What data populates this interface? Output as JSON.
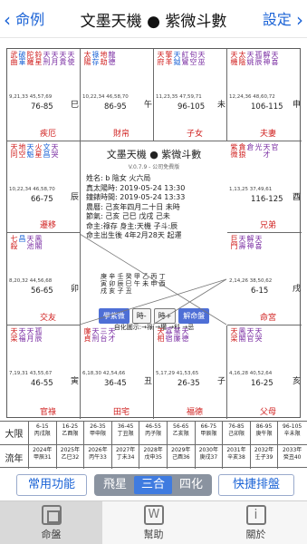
{
  "top": {
    "back_label": "命例",
    "title": "文墨天機 ● 紫微斗數",
    "settings_label": "設定"
  },
  "colors": {
    "red": "#d0201f",
    "blue": "#1b63d6",
    "purple": "#7b2fa3",
    "green": "#2c8a2c"
  },
  "cells": [
    {
      "id": "c1",
      "branch": "巳",
      "range": "76-85",
      "palace": "疾厄",
      "ages": "9,21,33\n45,57,69",
      "stars": [
        "武曲",
        "破軍",
        "陀羅",
        "鈴星",
        "天刑",
        "天月",
        "天貴",
        "天使",
        "天虛"
      ]
    },
    {
      "id": "c2",
      "branch": "午",
      "range": "86-95",
      "palace": "財帛",
      "ages": "10,22,34\n46,58,70",
      "stars": [
        "太陽",
        "祿存",
        "地劫",
        "龍德"
      ]
    },
    {
      "id": "c3",
      "branch": "未",
      "range": "96-105",
      "palace": "子女",
      "ages": "11,23,35\n47,59,71",
      "stars": [
        "天府",
        "擎羊",
        "天鉞",
        "紅鸞",
        "旬空",
        "天巫",
        "華蓋"
      ]
    },
    {
      "id": "c4",
      "branch": "申",
      "range": "106-115",
      "palace": "夫妻",
      "ages": "12,24,36\n48,60,72",
      "stars": [
        "天機",
        "太陰",
        "天姚",
        "孤辰",
        "解神",
        "天喜",
        "天廚",
        "天德"
      ]
    },
    {
      "id": "c5",
      "branch": "辰",
      "range": "66-75",
      "palace": "遷移",
      "ages": "10,22,34\n46,58,70",
      "stars": [
        "天同",
        "地空",
        "天魁",
        "火星",
        "文昌",
        "天哭",
        "大耗"
      ]
    },
    {
      "id": "c6",
      "branch": "酉",
      "range": "116-125",
      "palace": "兄弟",
      "ages": "1,13,25\n37,49,61",
      "stars": [
        "紫微",
        "貪狼",
        "倉",
        "光",
        "天才",
        "官",
        "天封",
        "誥"
      ]
    },
    {
      "id": "c7",
      "branch": "卯",
      "range": "56-65",
      "palace": "交友",
      "ages": "8,20,32\n44,56,68",
      "stars": [
        "七殺",
        "昌",
        "天池",
        "鳳閣"
      ]
    },
    {
      "id": "c8",
      "branch": "戌",
      "range": "6-15",
      "palace": "命宮",
      "ages": "2,14,26\n38,50,62",
      "stars": [
        "巨門",
        "天壽",
        "解神",
        "天喜"
      ]
    },
    {
      "id": "c9",
      "branch": "寅",
      "range": "46-55",
      "palace": "官祿",
      "ages": "7,19,31\n43,55,67",
      "stars": [
        "天梁",
        "天福",
        "天月",
        "孤辰"
      ]
    },
    {
      "id": "c10",
      "branch": "丑",
      "range": "36-45",
      "palace": "田宅",
      "ages": "6,18,30\n42,54,66",
      "stars": [
        "廉貞",
        "天刑",
        "三台",
        "天才"
      ]
    },
    {
      "id": "c11",
      "branch": "子",
      "range": "26-35",
      "palace": "福德",
      "ages": "5,17,29\n41,53,65",
      "stars": [
        "天相",
        "寡宿",
        "蜚廉",
        "天德"
      ]
    },
    {
      "id": "c12",
      "branch": "亥",
      "range": "16-25",
      "palace": "父母",
      "ages": "4,16,28\n40,52,64",
      "stars": [
        "天梁",
        "鳳閣",
        "天官",
        "天哭"
      ]
    }
  ],
  "center": {
    "title": "文墨天機 ● 紫微斗數",
    "version": "V.0.7.9 - 公司免費版",
    "rows": [
      "姓名: b        陰女 火六局",
      "真太陽時: 2019-05-24 13:30",
      "鐘錶時間: 2019-05-24 13:33",
      "農曆: 己亥年四月二十日 未時",
      "節氣: 己亥 己巳 戊戌 己未",
      "命主:祿存 身主:天機 子斗:辰",
      "命主出生後 4年2月28天 起運"
    ],
    "stems": [
      "庚 辛 壬 癸 甲 乙 丙 丁",
      "寅 卯 辰 巳 午 未 申 酉",
      "戌 亥 子 丑"
    ],
    "buttons": [
      "學紫微",
      "時-",
      "時+",
      "解命盤"
    ],
    "legend": "自化圖示:→祿 →權 →科 →忌"
  },
  "cycles": {
    "label_row1": "大限",
    "label_row2": "流年",
    "row1": [
      [
        "6-15",
        "丙戌限"
      ],
      [
        "16-25",
        "乙酉限"
      ],
      [
        "26-35",
        "甲申限"
      ],
      [
        "36-45",
        "丁丑限"
      ],
      [
        "46-55",
        "丙子限"
      ],
      [
        "56-65",
        "乙亥限"
      ],
      [
        "66-75",
        "甲辰限"
      ],
      [
        "76-85",
        "己卯限"
      ],
      [
        "86-95",
        "庚午限"
      ],
      [
        "96-105",
        "辛未限"
      ]
    ],
    "row2": [
      [
        "2024年",
        "甲辰31"
      ],
      [
        "2025年",
        "乙巳32"
      ],
      [
        "2026年",
        "丙午33"
      ],
      [
        "2027年",
        "丁未34"
      ],
      [
        "2028年",
        "戊申35"
      ],
      [
        "2029年",
        "己酉36"
      ],
      [
        "2030年",
        "庚戌37"
      ],
      [
        "2031年",
        "辛亥38"
      ],
      [
        "2032年",
        "壬子39"
      ],
      [
        "2033年",
        "癸丑40"
      ]
    ]
  },
  "controls": {
    "common_label": "常用功能",
    "seg1": "飛星",
    "seg2": "三合",
    "seg3": "四化",
    "quick_label": "快捷排盤"
  },
  "tabs": [
    {
      "label": "命盤",
      "icon": "chart-icon",
      "active": true
    },
    {
      "label": "幫助",
      "icon": "help-icon",
      "active": false
    },
    {
      "label": "關於",
      "icon": "info-icon",
      "active": false
    }
  ]
}
